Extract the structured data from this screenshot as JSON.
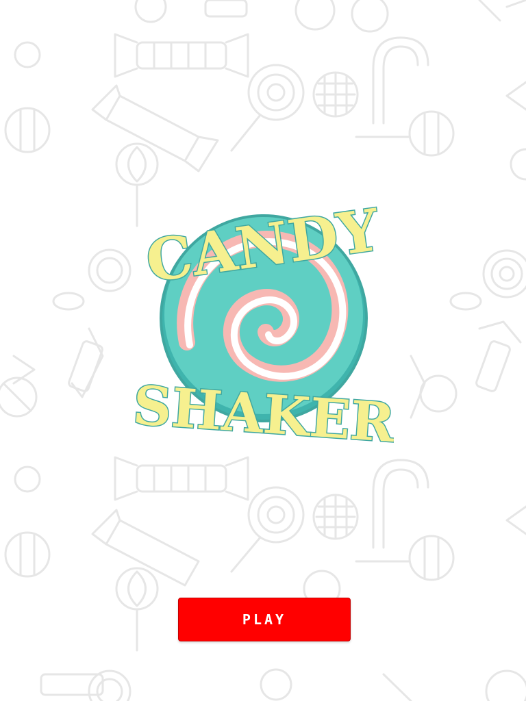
{
  "game": {
    "title_line1": "CANDY",
    "title_line2": "SHAKER"
  },
  "menu": {
    "play_label": "PLAY"
  },
  "colors": {
    "background": "#ffffff",
    "pattern_stroke": "#e6e6e6",
    "swirl_teal": "#5fcfc3",
    "swirl_dark_teal": "#3fb4ad",
    "swirl_pink": "#f7b8b3",
    "title_fill": "#f6f08f",
    "title_outline": "#3fa7a0",
    "play_button": "#ff0000"
  },
  "icons": {
    "background": "candy-pattern-icon",
    "logo": "lollipop-swirl-icon"
  }
}
